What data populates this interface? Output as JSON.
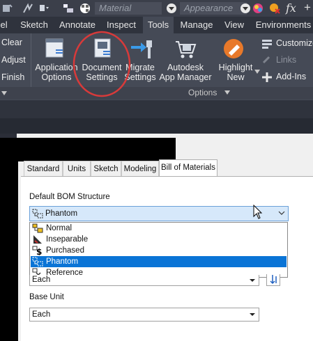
{
  "qat": {
    "material_placeholder": "Material",
    "appearance_placeholder": "Appearance",
    "fx_label": "fx",
    "plus_label": "+"
  },
  "tabs": [
    {
      "label": "del"
    },
    {
      "label": "Sketch"
    },
    {
      "label": "Annotate"
    },
    {
      "label": "Inspect"
    },
    {
      "label": "Tools"
    },
    {
      "label": "Manage"
    },
    {
      "label": "View"
    },
    {
      "label": "Environments"
    }
  ],
  "ribbon": {
    "left_items": [
      "Clear",
      "Adjust",
      "Finish"
    ],
    "buttons": [
      {
        "line1": "Application",
        "line2": "Options"
      },
      {
        "line1": "Document",
        "line2": "Settings"
      },
      {
        "line1": "Migrate",
        "line2": "Settings"
      },
      {
        "line1": "Autodesk",
        "line2": "App Manager"
      },
      {
        "line1": "Highlight",
        "line2": "New"
      }
    ],
    "right_items": [
      "Customize",
      "Links",
      "Add-Ins"
    ],
    "panel_label": "Options"
  },
  "dialog": {
    "tabs": [
      "Standard",
      "Units",
      "Sketch",
      "Modeling",
      "Bill of Materials"
    ],
    "active_tab": "Bill of Materials",
    "bom_label": "Default BOM Structure",
    "bom_selected": "Phantom",
    "bom_options": [
      "Normal",
      "Inseparable",
      "Purchased",
      "Phantom",
      "Reference"
    ],
    "hidden_combo_value": "Each",
    "base_unit_label": "Base Unit",
    "base_unit_value": "Each"
  },
  "colors": {
    "accent_red": "#d83a3a",
    "selection": "#0a74d6"
  }
}
